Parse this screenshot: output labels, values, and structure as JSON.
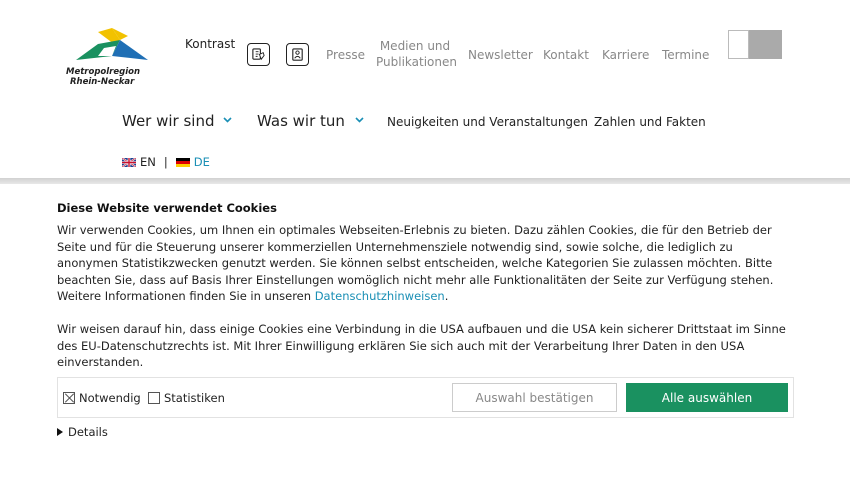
{
  "header": {
    "logo_text_line1": "Metropolregion",
    "logo_text_line2": "Rhein-Neckar",
    "kontrast_label": "Kontrast",
    "sign_language_icon": "sign-language-icon",
    "easy_language_icon": "easy-language-icon",
    "top_links": [
      "Presse",
      "Medien und Publikationen",
      "Newsletter",
      "Kontakt",
      "Karriere",
      "Termine"
    ],
    "contrast_swatches": [
      "#ffffff",
      "#aaaaaa"
    ]
  },
  "nav": {
    "items": [
      "Wer wir sind",
      "Was wir tun",
      "Neuigkeiten und Veranstaltungen",
      "Zahlen und Fakten"
    ]
  },
  "language": {
    "en": "EN",
    "separator": "|",
    "de": "DE",
    "active": "DE"
  },
  "cookie": {
    "title": "Diese Website verwendet Cookies",
    "paragraph1": "Wir verwenden Cookies, um Ihnen ein optimales Webseiten-Erlebnis zu bieten. Dazu zählen Cookies, die für den Betrieb der Seite und für die Steuerung unserer kommerziellen Unternehmensziele notwendig sind, sowie solche, die lediglich zu anonymen Statistikzwecken genutzt werden. Sie können selbst entscheiden, welche Kategorien Sie zulassen möchten. Bitte beachten Sie, dass auf Basis Ihrer Einstellungen womöglich nicht mehr alle Funktionalitäten der Seite zur Verfügung stehen. Weitere Informationen finden Sie in unseren ",
    "privacy_link": "Datenschutzhinweisen",
    "paragraph1_end": ".",
    "paragraph2": "Wir weisen darauf hin, dass einige Cookies eine Verbindung in die USA aufbauen und die USA kein sicherer Drittstaat im Sinne des EU-Datenschutzrechts ist. Mit Ihrer Einwilligung erklären Sie sich auch mit der Verarbeitung Ihrer Daten in den USA einverstanden.",
    "checkboxes": [
      {
        "label": "Notwendig",
        "checked": true
      },
      {
        "label": "Statistiken",
        "checked": false
      }
    ],
    "confirm_button": "Auswahl bestätigen",
    "accept_all_button": "Alle auswählen",
    "details_label": "Details"
  },
  "colors": {
    "accent_link": "#1a8fb5",
    "accept_button": "#1a9160",
    "logo_yellow": "#f2c200",
    "logo_green": "#2a9a4a",
    "logo_blue": "#1f6fb5"
  }
}
